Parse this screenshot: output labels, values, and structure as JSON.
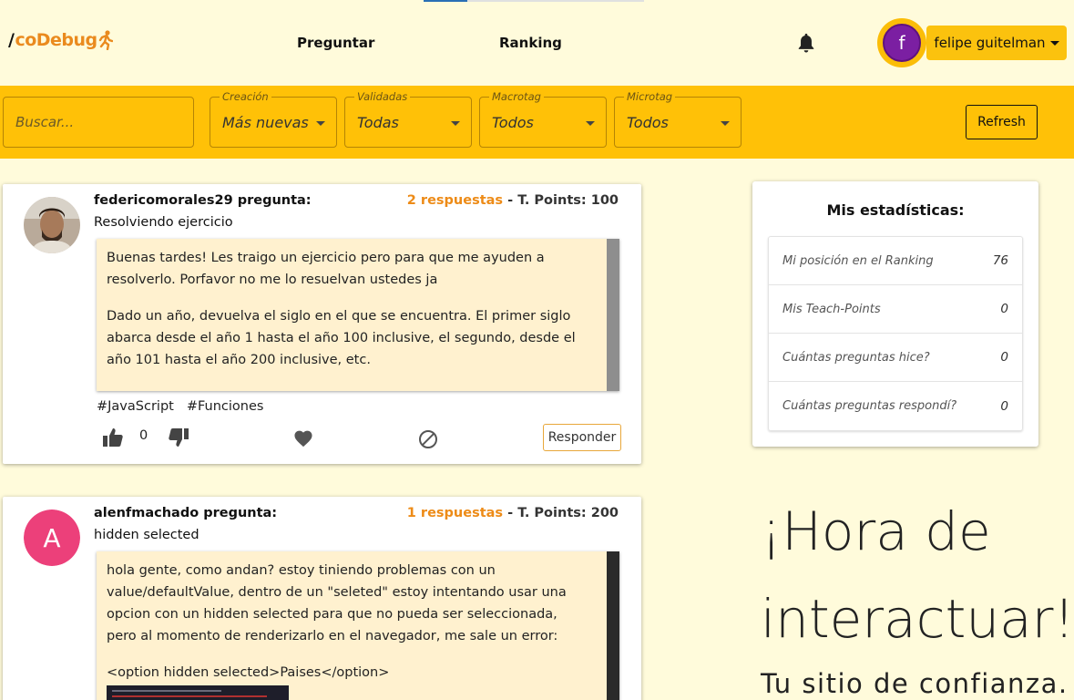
{
  "header": {
    "logo_slash": "/",
    "logo_text": "coDebug",
    "nav": [
      "Preguntar",
      "Ranking"
    ],
    "avatar_letter": "f",
    "user_name": "felipe guitelman"
  },
  "filters": {
    "search_placeholder": "Buscar...",
    "selects": [
      {
        "label": "Creación",
        "value": "Más nuevas"
      },
      {
        "label": "Validadas",
        "value": "Todas"
      },
      {
        "label": "Macrotag",
        "value": "Todos"
      },
      {
        "label": "Microtag",
        "value": "Todos"
      }
    ],
    "refresh_label": "Refresh"
  },
  "questions": [
    {
      "author": "federicomorales29 pregunta:",
      "title": "Resolviendo ejercicio",
      "answers": "2 respuestas",
      "meta_sep": " - ",
      "points": "T. Points: 100",
      "body": [
        "Buenas tardes! Les traigo un ejercicio pero para que me ayuden a resolverlo. Porfavor no me lo resuelvan ustedes ja",
        "Dado un año, devuelva el siglo en el que se encuentra. El primer siglo abarca desde el año 1 hasta el año 100 inclusive, el segundo, desde el año 101 hasta el año 200 inclusive, etc."
      ],
      "tags": [
        "#JavaScript",
        "#Funciones"
      ],
      "likes": "0",
      "respond_label": "Responder"
    },
    {
      "author": "alenfmachado pregunta:",
      "avatar_letter": "A",
      "title": "hidden selected",
      "answers": "1 respuestas",
      "meta_sep": " - ",
      "points": "T. Points: 200",
      "body": [
        "hola gente, como andan? estoy tiniendo problemas con un value/defaultValue, dentro de un \"seleted\" estoy intentando usar una opcion con un hidden selected para que no pueda ser seleccionada, pero al momento de renderizarlo en el navegador, me sale un error:",
        "<option hidden selected>Paises</option>"
      ]
    }
  ],
  "stats": {
    "title": "Mis estadísticas:",
    "rows": [
      {
        "label": "Mi posición en el Ranking",
        "value": "76"
      },
      {
        "label": "Mis Teach-Points",
        "value": "0"
      },
      {
        "label": "Cuántas preguntas hice?",
        "value": "0"
      },
      {
        "label": "Cuántas preguntas respondí?",
        "value": "0"
      }
    ]
  },
  "hero": {
    "line1": "¡Hora de",
    "line2": "interactuar!",
    "tagline": "Tu sitio de confianza."
  },
  "colors": {
    "accent": "#ffc107",
    "background": "#fffbdb",
    "answers": "#ed8b17"
  }
}
